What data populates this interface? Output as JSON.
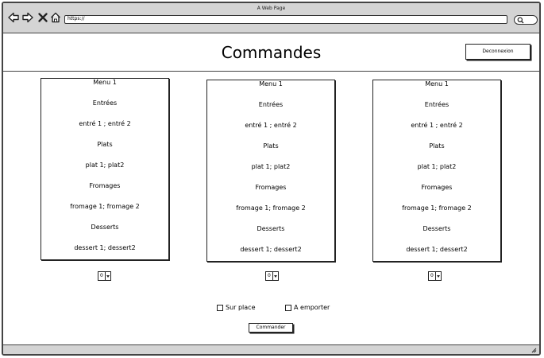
{
  "window": {
    "title": "A Web Page"
  },
  "browser": {
    "address": "https://"
  },
  "page": {
    "title": "Commandes",
    "logout_label": "Deconnexion"
  },
  "menus": [
    {
      "name": "Menu 1",
      "sections": [
        "Entrées",
        "entré 1 ; entré 2",
        "Plats",
        "plat 1; plat2",
        "Fromages",
        "fromage 1; fromage 2",
        "Desserts",
        "dessert 1; dessert2"
      ],
      "quantity": "0"
    },
    {
      "name": "Menu 1",
      "sections": [
        "Entrées",
        "entré 1 ; entré 2",
        "Plats",
        "plat 1; plat2",
        "Fromages",
        "fromage 1; fromage 2",
        "Desserts",
        "dessert 1; dessert2"
      ],
      "quantity": "0"
    },
    {
      "name": "Menu 1",
      "sections": [
        "Entrées",
        "entré 1 ; entré 2",
        "Plats",
        "plat 1; plat2",
        "Fromages",
        "fromage 1; fromage 2",
        "Desserts",
        "dessert 1; dessert2"
      ],
      "quantity": "0"
    }
  ],
  "options": {
    "dine_in": "Sur place",
    "takeaway": "A emporter"
  },
  "order_label": "Commander",
  "icons": [
    "back-arrow-icon",
    "forward-arrow-icon",
    "close-icon",
    "home-icon",
    "search-icon",
    "resize-grip-icon"
  ]
}
